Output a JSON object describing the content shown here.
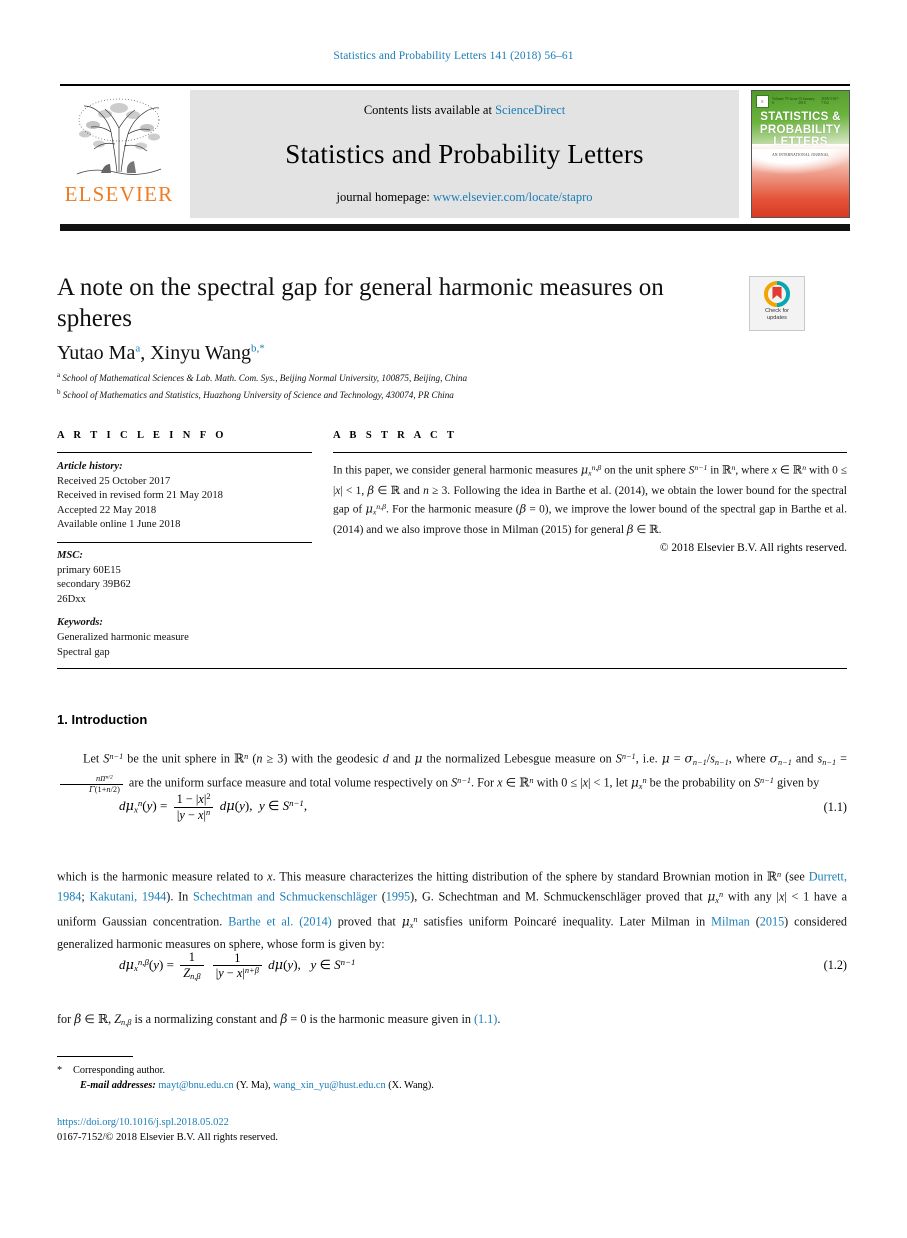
{
  "running_head": "Statistics and Probability Letters 141 (2018) 56–61",
  "masthead": {
    "contents_prefix": "Contents lists available at ",
    "sciencedirect": "ScienceDirect",
    "journal_name": "Statistics and Probability Letters",
    "homepage_prefix": "journal homepage: ",
    "homepage_url": "www.elsevier.com/locate/stapro",
    "publisher_wordmark": "ELSEVIER",
    "cover": {
      "title_line1": "STATISTICS &",
      "title_line2": "PROBABILITY",
      "title_line3": "LETTERS",
      "head_left": "Volume 79 Issue 6",
      "head_mid": "15 January 2018",
      "head_right": "ISSN 0167-7152",
      "subtitle": "AN INTERNATIONAL JOURNAL"
    }
  },
  "article": {
    "title": "A note on the spectral gap for general harmonic measures on spheres",
    "authors": [
      {
        "name": "Yutao Ma",
        "marks": "a"
      },
      {
        "name": "Xinyu Wang",
        "marks": "b,*"
      }
    ],
    "affiliations": [
      {
        "mark": "a",
        "text": "School of Mathematical Sciences & Lab. Math. Com. Sys., Beijing Normal University, 100875, Beijing, China"
      },
      {
        "mark": "b",
        "text": "School of Mathematics and Statistics, Huazhong University of Science and Technology, 430074, PR China"
      }
    ],
    "crossmark": {
      "line1": "Check for",
      "line2": "updates"
    }
  },
  "article_info": {
    "heading": "A R T I C L E    I N F O",
    "history_label": "Article history:",
    "history": [
      "Received 25 October 2017",
      "Received in revised form 21 May 2018",
      "Accepted 22 May 2018",
      "Available online 1 June 2018"
    ],
    "msc_label": "MSC:",
    "msc": [
      "primary 60E15",
      "secondary 39B62",
      "26Dxx"
    ],
    "keywords_label": "Keywords:",
    "keywords": [
      "Generalized harmonic measure",
      "Spectral gap"
    ]
  },
  "abstract": {
    "heading": "A B S T R A C T",
    "copyright": "© 2018 Elsevier B.V. All rights reserved."
  },
  "body": {
    "section1_title": "1. Introduction",
    "eq_1_1_number": "(1.1)",
    "eq_1_2_number": "(1.2)"
  },
  "footnotes": {
    "corresponding": "Corresponding author.",
    "email_label": "E-mail addresses:",
    "email1": "mayt@bnu.edu.cn",
    "email1_owner": "(Y. Ma)",
    "email2": "wang_xin_yu@hust.edu.cn",
    "email2_owner": "(X. Wang)",
    "doi": "https://doi.org/10.1016/j.spl.2018.05.022",
    "issn_line": "0167-7152/© 2018 Elsevier B.V. All rights reserved."
  },
  "colors": {
    "link": "#1a7db6",
    "elsevier_orange": "#ef7c22",
    "band_gray": "#e3e3e3"
  }
}
